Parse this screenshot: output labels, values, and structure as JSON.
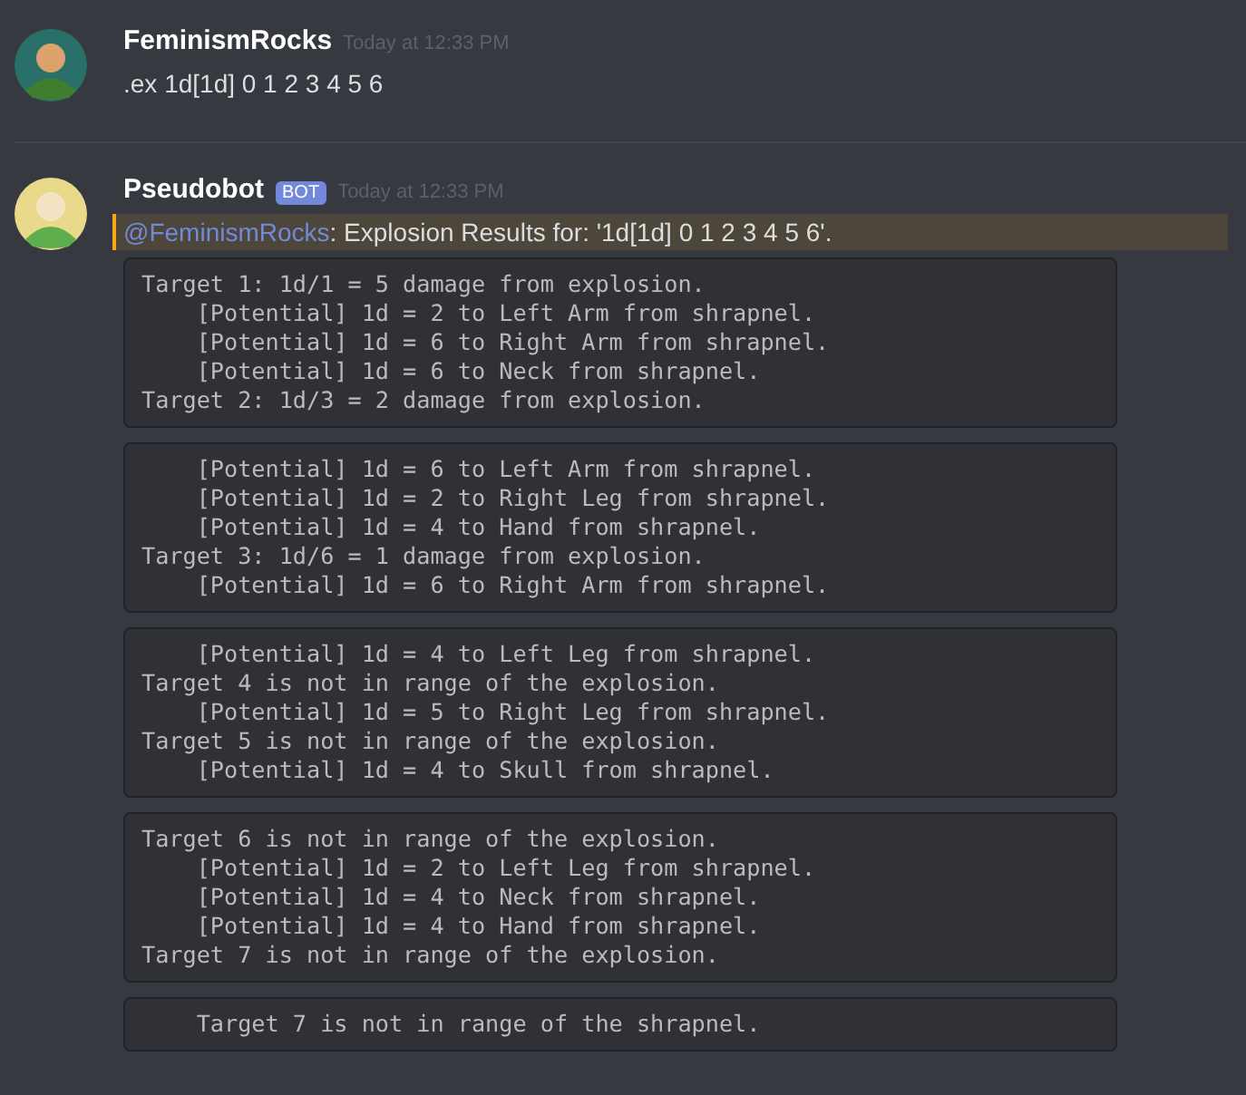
{
  "messages": [
    {
      "author": "FeminismRocks",
      "timestamp": "Today at 12:33 PM",
      "text": ".ex 1d[1d] 0 1 2 3 4 5 6",
      "highlighted": false
    },
    {
      "author": "Pseudobot",
      "bot_badge": "BOT",
      "timestamp": "Today at 12:33 PM",
      "text": ": Explosion Results for: '1d[1d] 0 1 2 3 4 5 6'.",
      "highlighted": true,
      "mention": "@FeminismRocks",
      "code_blocks": [
        "Target 1: 1d/1 = 5 damage from explosion.\n    [Potential] 1d = 2 to Left Arm from shrapnel.\n    [Potential] 1d = 6 to Right Arm from shrapnel.\n    [Potential] 1d = 6 to Neck from shrapnel.\nTarget 2: 1d/3 = 2 damage from explosion.",
        "    [Potential] 1d = 6 to Left Arm from shrapnel.\n    [Potential] 1d = 2 to Right Leg from shrapnel.\n    [Potential] 1d = 4 to Hand from shrapnel.\nTarget 3: 1d/6 = 1 damage from explosion.\n    [Potential] 1d = 6 to Right Arm from shrapnel.",
        "    [Potential] 1d = 4 to Left Leg from shrapnel.\nTarget 4 is not in range of the explosion.\n    [Potential] 1d = 5 to Right Leg from shrapnel.\nTarget 5 is not in range of the explosion.\n    [Potential] 1d = 4 to Skull from shrapnel.",
        "Target 6 is not in range of the explosion.\n    [Potential] 1d = 2 to Left Leg from shrapnel.\n    [Potential] 1d = 4 to Neck from shrapnel.\n    [Potential] 1d = 4 to Hand from shrapnel.\nTarget 7 is not in range of the explosion.",
        "    Target 7 is not in range of the shrapnel."
      ]
    }
  ]
}
